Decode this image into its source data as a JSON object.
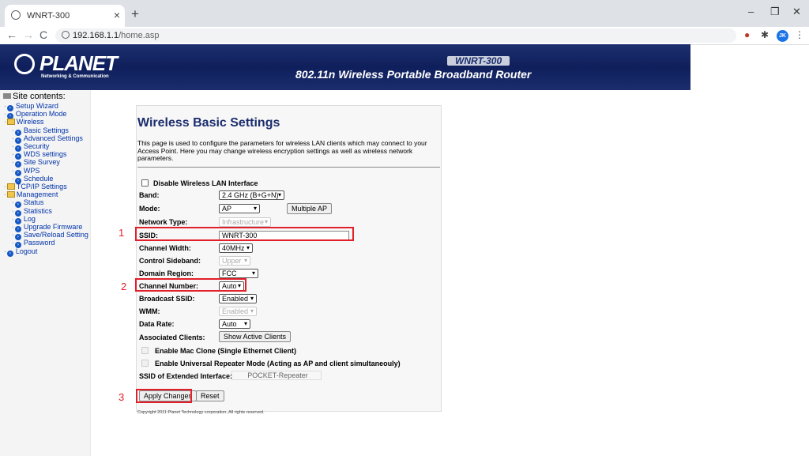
{
  "browser": {
    "tab_title": "WNRT-300",
    "tab_close": "×",
    "new_tab": "+",
    "url_host": "192.168.1.1",
    "url_path": "/home.asp",
    "profile_initials": "JK",
    "window_controls": [
      "–",
      "❐",
      "✕"
    ],
    "nav": [
      "←",
      "→",
      "C"
    ]
  },
  "header": {
    "logo_text": "PLANET",
    "logo_subtitle": "Networking & Communication",
    "model": "WNRT-300",
    "product": "802.11n Wireless Portable Broadband Router"
  },
  "sidebar": {
    "title": "Site contents:",
    "items": [
      {
        "label": "Setup Wizard",
        "type": "page",
        "level": 0
      },
      {
        "label": "Operation Mode",
        "type": "page",
        "level": 0
      },
      {
        "label": "Wireless",
        "type": "folder",
        "level": 0
      },
      {
        "label": "Basic Settings",
        "type": "page",
        "level": 1
      },
      {
        "label": "Advanced Settings",
        "type": "page",
        "level": 1
      },
      {
        "label": "Security",
        "type": "page",
        "level": 1
      },
      {
        "label": "WDS settings",
        "type": "page",
        "level": 1
      },
      {
        "label": "Site Survey",
        "type": "page",
        "level": 1
      },
      {
        "label": "WPS",
        "type": "page",
        "level": 1
      },
      {
        "label": "Schedule",
        "type": "page",
        "level": 1
      },
      {
        "label": "TCP/IP Settings",
        "type": "folder",
        "level": 0
      },
      {
        "label": "Management",
        "type": "folder",
        "level": 0
      },
      {
        "label": "Status",
        "type": "page",
        "level": 1
      },
      {
        "label": "Statistics",
        "type": "page",
        "level": 1
      },
      {
        "label": "Log",
        "type": "page",
        "level": 1
      },
      {
        "label": "Upgrade Firmware",
        "type": "page",
        "level": 1
      },
      {
        "label": "Save/Reload Setting",
        "type": "page",
        "level": 1
      },
      {
        "label": "Password",
        "type": "page",
        "level": 1
      },
      {
        "label": "Logout",
        "type": "page",
        "level": 0
      }
    ]
  },
  "main": {
    "title": "Wireless Basic Settings",
    "description": "This page is used to configure the parameters for wireless LAN clients which may connect to your Access Point. Here you may change wireless encryption settings as well as wireless network parameters.",
    "disable_wlan_label": "Disable Wireless LAN Interface",
    "band_label": "Band:",
    "band_value": "2.4 GHz (B+G+N)",
    "mode_label": "Mode:",
    "mode_value": "AP",
    "multiple_ap_button": "Multiple AP",
    "network_type_label": "Network Type:",
    "network_type_value": "Infrastructure",
    "ssid_label": "SSID:",
    "ssid_value": "WNRT-300",
    "channel_width_label": "Channel Width:",
    "channel_width_value": "40MHz",
    "control_sideband_label": "Control Sideband:",
    "control_sideband_value": "Upper",
    "domain_region_label": "Domain Region:",
    "domain_region_value": "FCC",
    "channel_number_label": "Channel Number:",
    "channel_number_value": "Auto",
    "broadcast_ssid_label": "Broadcast SSID:",
    "broadcast_ssid_value": "Enabled",
    "wmm_label": "WMM:",
    "wmm_value": "Enabled",
    "data_rate_label": "Data Rate:",
    "data_rate_value": "Auto",
    "associated_clients_label": "Associated Clients:",
    "show_active_clients_button": "Show Active Clients",
    "mac_clone_label": "Enable Mac Clone (Single Ethernet Client)",
    "repeater_label": "Enable Universal Repeater Mode (Acting as AP and client simultaneouly)",
    "ssid_extended_label": "SSID of Extended Interface:",
    "ssid_extended_value": "POCKET-Repeater",
    "apply_button": "Apply Changes",
    "reset_button": "Reset",
    "copyright": "Copyright 2011 Planet Technology corporation, All rights reserved."
  },
  "annotations": {
    "labels": [
      "1",
      "2",
      "3"
    ],
    "color": "#e2202a"
  }
}
